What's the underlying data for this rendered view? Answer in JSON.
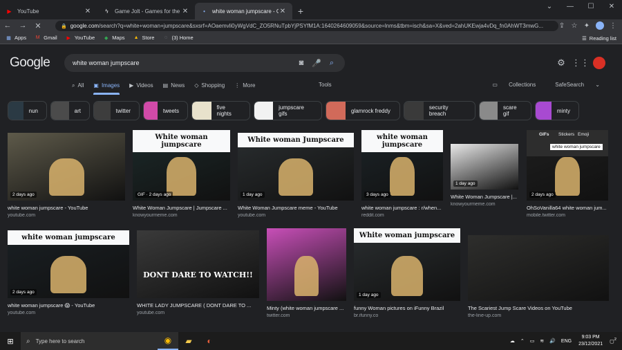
{
  "browser": {
    "tabs": [
      {
        "title": "YouTube",
        "icon": "youtube-icon",
        "active": false
      },
      {
        "title": "Game Jolt - Games for the love of it",
        "icon": "gamejolt-icon",
        "active": false
      },
      {
        "title": "white woman jumpscare - Google Search",
        "icon": "google-icon",
        "active": true
      }
    ],
    "url_host": "google.com",
    "url_rest": "/search?q=white+woman+jumpscare&sxsrf=AOaemvli0yWgVdC_ZO5RNuTpbYjPSYfM1A:1640264609059&source=lnms&tbm=isch&sa=X&ved=2ahUKEwja4vDq_fn0AhWT3mwG...",
    "bookmarks": [
      {
        "label": "Apps",
        "icon": "apps-grid-icon"
      },
      {
        "label": "Gmail",
        "icon": "gmail-icon"
      },
      {
        "label": "YouTube",
        "icon": "youtube-icon"
      },
      {
        "label": "Maps",
        "icon": "maps-icon"
      },
      {
        "label": "Store",
        "icon": "store-icon"
      },
      {
        "label": "(3) Home",
        "icon": "home-icon"
      }
    ],
    "reading_list": "Reading list"
  },
  "google": {
    "logo": "Google",
    "query": "white woman jumpscare",
    "tabs": [
      {
        "label": "All",
        "icon": "search-icon",
        "active": false
      },
      {
        "label": "Images",
        "icon": "image-icon",
        "active": true
      },
      {
        "label": "Videos",
        "icon": "video-icon",
        "active": false
      },
      {
        "label": "News",
        "icon": "news-icon",
        "active": false
      },
      {
        "label": "Shopping",
        "icon": "tag-icon",
        "active": false
      },
      {
        "label": "More",
        "icon": "more-icon",
        "active": false
      }
    ],
    "tools": "Tools",
    "collections": "Collections",
    "safesearch": "SafeSearch",
    "chips": [
      {
        "label": "nun",
        "color": "#2b3a44"
      },
      {
        "label": "art",
        "color": "#4b4b4b"
      },
      {
        "label": "twitter",
        "color": "#3d3d3d"
      },
      {
        "label": "tweets",
        "color": "#d14aa8"
      },
      {
        "label": "five nights",
        "color": "#e8e2cc"
      },
      {
        "label": "jumpscare gifs",
        "color": "#f2f2f2"
      },
      {
        "label": "glamrock freddy",
        "color": "#d16a5a"
      },
      {
        "label": "security breach",
        "color": "#3a3a3a"
      },
      {
        "label": "scare gif",
        "color": "#8a8a8a"
      },
      {
        "label": "minty",
        "color": "#a84ad1"
      }
    ]
  },
  "results": [
    {
      "caption": "white woman jumpscare - YouTube",
      "source": "youtube.com",
      "badge": "2 days ago",
      "banner": "",
      "color": "#5e5a4a"
    },
    {
      "caption": "White Woman Jumpscare | Jumpscare ...",
      "source": "knowyourmeme.com",
      "badge": "GIF · 2 days ago",
      "banner": "White woman jumpscare",
      "color": "#1c2a2a"
    },
    {
      "caption": "White Woman Jumpscare meme - YouTube",
      "source": "youtube.com",
      "badge": "1 day ago",
      "banner": "White woman Jumpscare",
      "color": "#2a2e30"
    },
    {
      "caption": "white woman jumpscare : r/when...",
      "source": "reddit.com",
      "badge": "3 days ago",
      "banner": "white woman jumpscare",
      "color": "#1c2428"
    },
    {
      "caption": "White Woman Jumpscare |...",
      "source": "knowyourmeme.com",
      "badge": "1 day ago",
      "banner": "",
      "color": "#e8e8e8"
    },
    {
      "caption": "OhSoVanilla64 white woman jum...",
      "source": "mobile.twitter.com",
      "badge": "2 days ago",
      "banner": "",
      "color": "#1f1f1f"
    },
    {
      "caption": "white woman jumpscare 😱 - YouTube",
      "source": "youtube.com",
      "badge": "2 days ago",
      "banner": "white woman jumpscare",
      "color": "#1a2024"
    },
    {
      "caption": "WHITE LADY JUMPSCARE ( DONT DARE TO ...",
      "source": "youtube.com",
      "badge": "",
      "banner": "",
      "color": "#3a3a3a"
    },
    {
      "caption": "Minty (white woman jumpscare ...",
      "source": "twitter.com",
      "badge": "",
      "banner": "",
      "color": "#c84fb8"
    },
    {
      "caption": "funny Woman pictures on iFunny Brazil",
      "source": "br.ifunny.co",
      "badge": "1 day ago",
      "banner": "White woman jumpscare",
      "color": "#2a2e30"
    },
    {
      "caption": "The Scariest Jump Scare Videos on YouTube",
      "source": "the-line-up.com",
      "badge": "",
      "banner": "",
      "color": "#2e2e2c"
    }
  ],
  "gif_panel": {
    "tabs": [
      "GIFs",
      "Stickers",
      "Emoji"
    ],
    "query": "white woman jumpscare"
  },
  "overlay_texts": {
    "dont_dare": "DONT DARE TO WATCH!!"
  },
  "taskbar": {
    "search_placeholder": "Type here to search",
    "lang": "ENG",
    "time": "9:03 PM",
    "date": "23/12/2021",
    "notifications": "2"
  }
}
